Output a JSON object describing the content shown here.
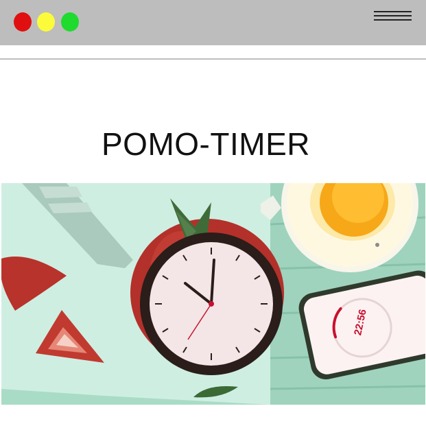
{
  "window": {
    "controls": [
      {
        "name": "close-dot",
        "color": "#e01010"
      },
      {
        "name": "minimize-dot",
        "color": "#fbfb3b"
      },
      {
        "name": "maximize-dot",
        "color": "#1fdb2d"
      }
    ],
    "menu_icon": "hamburger-menu-icon"
  },
  "header": {
    "title": "POMO-TIMER"
  },
  "hero": {
    "phone_timer": "22:56",
    "colors": {
      "background": "#cfeee2",
      "tomato": "#b3312a",
      "clock_face": "#f4e6e6",
      "clock_rim": "#2a1d1a",
      "egg_yolk": "#f6a818",
      "phone_accent": "#c8102e"
    }
  }
}
